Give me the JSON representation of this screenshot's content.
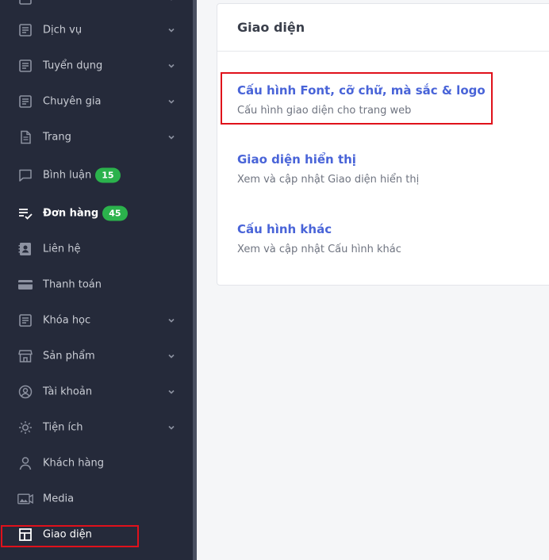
{
  "sidebar": {
    "items": [
      {
        "label": "Dịch vụ",
        "icon": "document-icon",
        "has_chevron": true
      },
      {
        "label": "Tuyển dụng",
        "icon": "document-icon",
        "has_chevron": true
      },
      {
        "label": "Chuyên gia",
        "icon": "document-icon",
        "has_chevron": true
      },
      {
        "label": "Trang",
        "icon": "page-icon",
        "has_chevron": true
      },
      {
        "label": "Bình luận",
        "icon": "comment-icon",
        "badge": "15"
      },
      {
        "label": "Đơn hàng",
        "icon": "order-check-icon",
        "badge": "45"
      },
      {
        "label": "Liên hệ",
        "icon": "contact-card-icon"
      },
      {
        "label": "Thanh toán",
        "icon": "credit-card-icon"
      },
      {
        "label": "Khóa học",
        "icon": "document-icon",
        "has_chevron": true
      },
      {
        "label": "Sản phẩm",
        "icon": "store-icon",
        "has_chevron": true
      },
      {
        "label": "Tài khoản",
        "icon": "user-circle-icon",
        "has_chevron": true
      },
      {
        "label": "Tiện ích",
        "icon": "sun-icon",
        "has_chevron": true
      },
      {
        "label": "Khách hàng",
        "icon": "person-icon"
      },
      {
        "label": "Media",
        "icon": "media-icon"
      },
      {
        "label": "Giao diện",
        "icon": "layout-icon",
        "active": true
      }
    ]
  },
  "main": {
    "card_title": "Giao diện",
    "settings": [
      {
        "title": "Cấu hình Font, cỡ chữ, mà sắc & logo",
        "desc": "Cấu hình giao diện cho trang web"
      },
      {
        "title": "Giao diện hiển thị",
        "desc": "Xem và cập nhật Giao diện hiển thị"
      },
      {
        "title": "Cấu hình khác",
        "desc": "Xem và cập nhật Cấu hình khác"
      }
    ]
  },
  "colors": {
    "sidebar_bg": "#252a3a",
    "accent_link": "#4964d8",
    "badge_green": "#2bb24c",
    "highlight_red": "#e0111b"
  }
}
